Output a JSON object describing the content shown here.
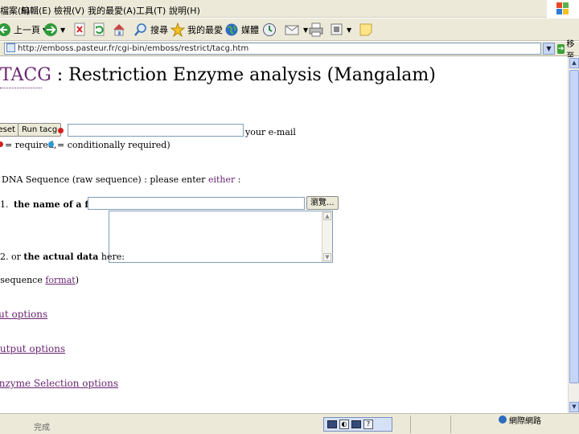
{
  "menu": [
    "檔案(F)",
    "編輯(E)",
    "檢視(V)",
    "我的最愛(A)",
    "工具(T)",
    "說明(H)"
  ],
  "toolbar": {
    "back_label": "上一頁",
    "search_label": "搜尋",
    "favorites_label": "我的最愛",
    "media_label": "媒體"
  },
  "address": {
    "url": "http://emboss.pasteur.fr/cgi-bin/emboss/restrict/tacg.htm",
    "go_label": "移至"
  },
  "page": {
    "brand": "TACG",
    "title_rest": " : Restriction Enzyme analysis (Mangalam)",
    "reset_label": "Reset",
    "run_label": "Run tacg",
    "email_suffix": "your e-mail",
    "required_note": "= required,",
    "conditional_note": "= conditionally required)",
    "dna_intro": "DNA Sequence (raw sequence) : please enter",
    "either": "either",
    "dna_colon": ":",
    "item1_num": "1.",
    "item1_label": "the name of a file:",
    "browse_label": "瀏覽...",
    "item2_num": "2.",
    "item2_or": "or",
    "item2_bold": "the actual data",
    "item2_rest": "here:",
    "seq_prefix": "(sequence ",
    "format_link": "format",
    "seq_suffix": ")",
    "input_options": "Input options",
    "output_options": "Output options",
    "enzyme_options": "Enzyme Selection options"
  },
  "status": {
    "zone_label": "網際網路",
    "left_text": "完成"
  },
  "colors": {
    "link": "#6a2672",
    "required_dot": "#d42020",
    "conditional_dot": "#2a9ad6",
    "chrome": "#ece9d8"
  }
}
